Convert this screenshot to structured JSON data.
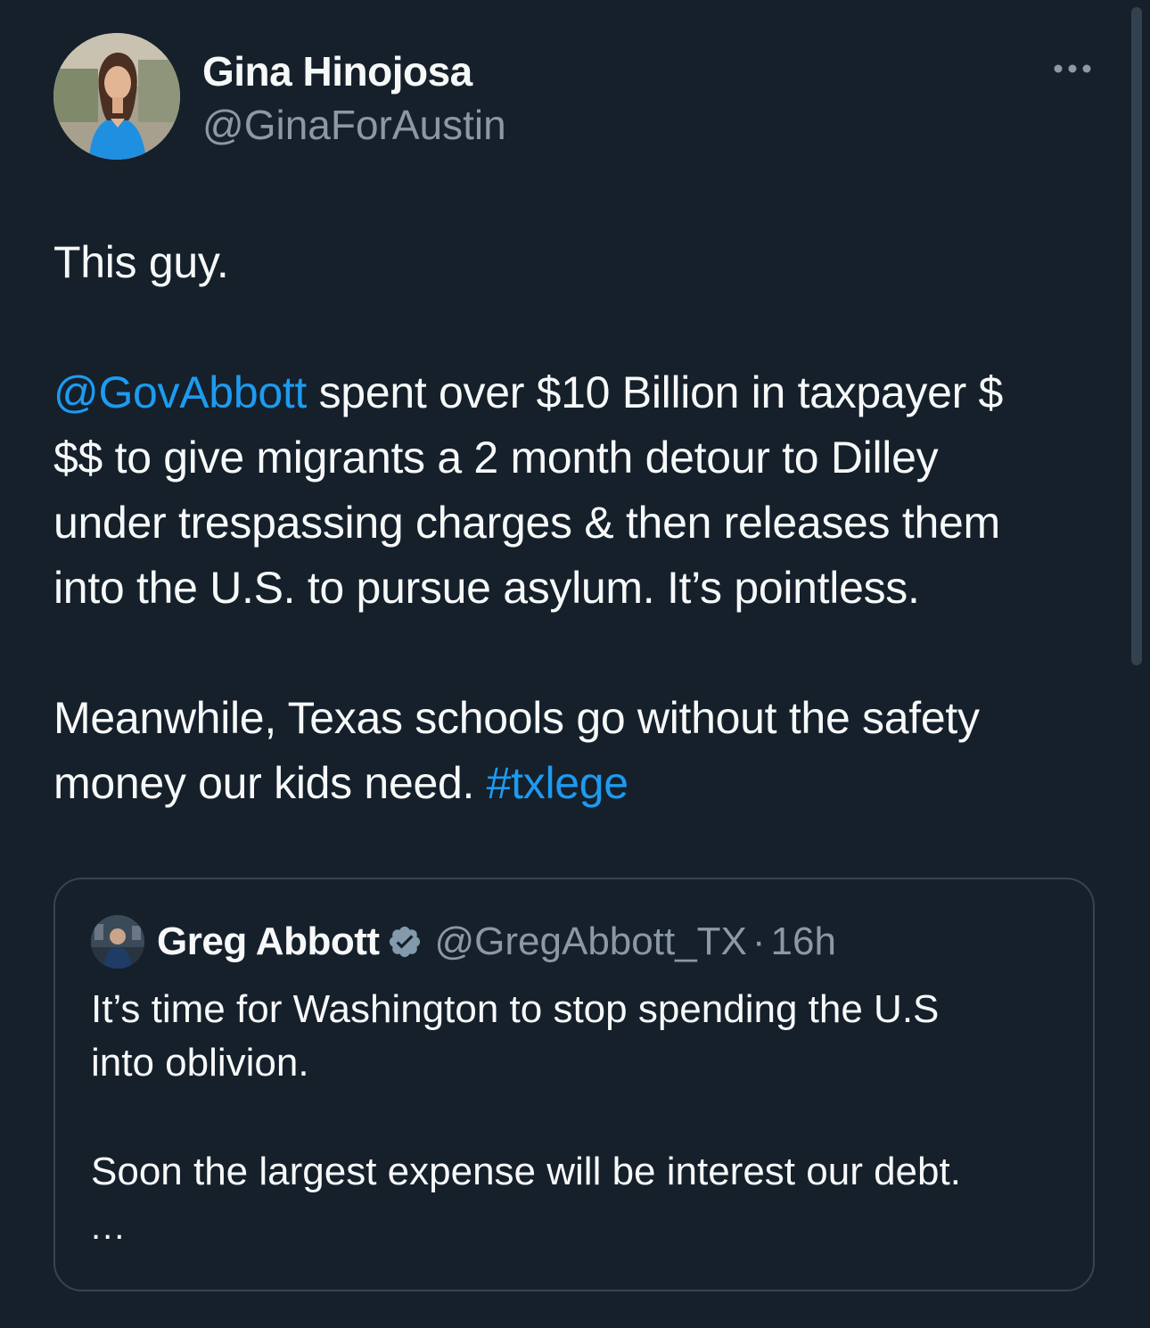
{
  "author": {
    "name": "Gina Hinojosa",
    "handle": "@GinaForAustin",
    "avatar_icon": "profile-photo"
  },
  "menu": {
    "icon": "more-horizontal-icon"
  },
  "tweet": {
    "line1": "This guy.",
    "mention": "@GovAbbott",
    "line2_rest": " spent over $10 Billion in taxpayer $",
    "line3": "$$ to give migrants a 2 month detour to Dilley",
    "line4": "under trespassing charges & then releases them",
    "line5": "into the U.S. to pursue asylum. It’s pointless.",
    "line6": "Meanwhile, Texas schools go without the safety",
    "line7": "money our kids need. ",
    "hashtag": "#txlege"
  },
  "quoted": {
    "name": "Greg Abbott",
    "handle": "@GregAbbott_TX",
    "separator": "·",
    "time": "16h",
    "verified_icon": "verified-badge-icon",
    "text_line1": "It’s time for Washington to stop spending the U.S",
    "text_line2": "into oblivion.",
    "text_line3": "Soon the largest expense will be interest our debt.",
    "ellipsis": "..."
  },
  "colors": {
    "background": "#15202b",
    "link": "#1d9bf0",
    "text": "#f7f9f9",
    "secondary": "#8b98a5",
    "border": "#38444d"
  }
}
